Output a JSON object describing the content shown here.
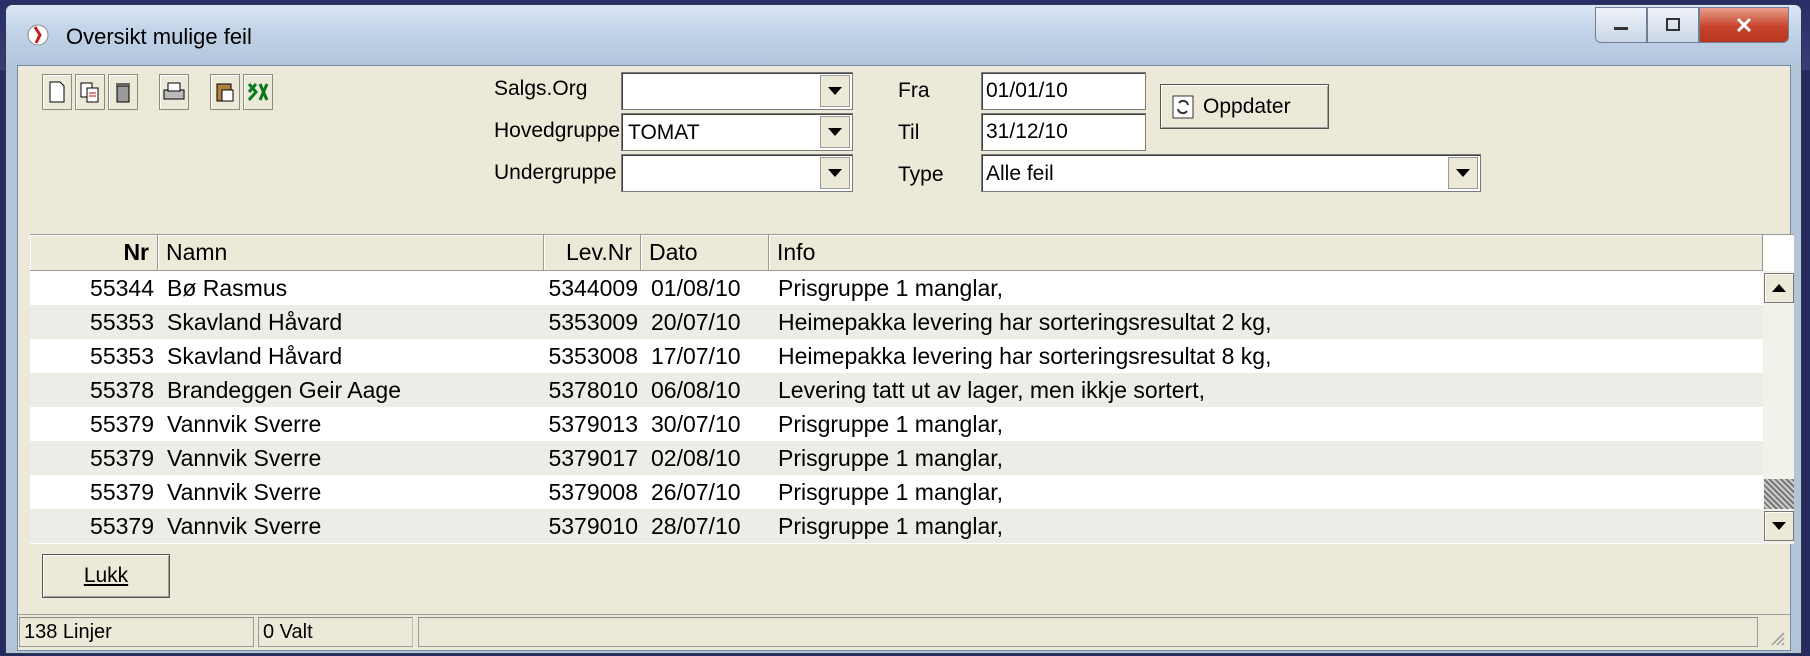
{
  "window": {
    "title": "Oversikt mulige feil"
  },
  "toolbar": {
    "icons": [
      "new-document-icon",
      "copy-icon",
      "delete-icon",
      "print-icon",
      "paste-icon",
      "excel-icon"
    ]
  },
  "filters": {
    "salgs_org_label": "Salgs.Org",
    "salgs_org_value": "",
    "hovedgruppe_label": "Hovedgruppe",
    "hovedgruppe_value": "TOMAT",
    "undergruppe_label": "Undergruppe",
    "undergruppe_value": "",
    "fra_label": "Fra",
    "fra_value": "01/01/10",
    "til_label": "Til",
    "til_value": "31/12/10",
    "type_label": "Type",
    "type_value": "Alle feil",
    "oppdater_label": "Oppdater"
  },
  "grid": {
    "columns": [
      "Nr",
      "Namn",
      "Lev.Nr",
      "Dato",
      "Info"
    ],
    "rows": [
      {
        "nr": "55344",
        "namn": "Bø Rasmus",
        "levnr": "5344009",
        "dato": "01/08/10",
        "info": "Prisgruppe 1 manglar,"
      },
      {
        "nr": "55353",
        "namn": "Skavland Håvard",
        "levnr": "5353009",
        "dato": "20/07/10",
        "info": "Heimepakka levering har sorteringsresultat 2 kg,"
      },
      {
        "nr": "55353",
        "namn": "Skavland Håvard",
        "levnr": "5353008",
        "dato": "17/07/10",
        "info": "Heimepakka levering har sorteringsresultat 8 kg,"
      },
      {
        "nr": "55378",
        "namn": "Brandeggen Geir Aage",
        "levnr": "5378010",
        "dato": "06/08/10",
        "info": "Levering tatt ut av lager, men ikkje sortert,"
      },
      {
        "nr": "55379",
        "namn": "Vannvik Sverre",
        "levnr": "5379013",
        "dato": "30/07/10",
        "info": "Prisgruppe 1 manglar,"
      },
      {
        "nr": "55379",
        "namn": "Vannvik Sverre",
        "levnr": "5379017",
        "dato": "02/08/10",
        "info": "Prisgruppe 1 manglar,"
      },
      {
        "nr": "55379",
        "namn": "Vannvik Sverre",
        "levnr": "5379008",
        "dato": "26/07/10",
        "info": "Prisgruppe 1 manglar,"
      },
      {
        "nr": "55379",
        "namn": "Vannvik Sverre",
        "levnr": "5379010",
        "dato": "28/07/10",
        "info": "Prisgruppe 1 manglar,"
      }
    ]
  },
  "buttons": {
    "lukk_label": "Lukk"
  },
  "status": {
    "lines": "138 Linjer",
    "selected": "0 Valt"
  },
  "colors": {
    "row_alt": "#eeece6",
    "face": "#ece9d8",
    "close_button": "#c7432a"
  }
}
